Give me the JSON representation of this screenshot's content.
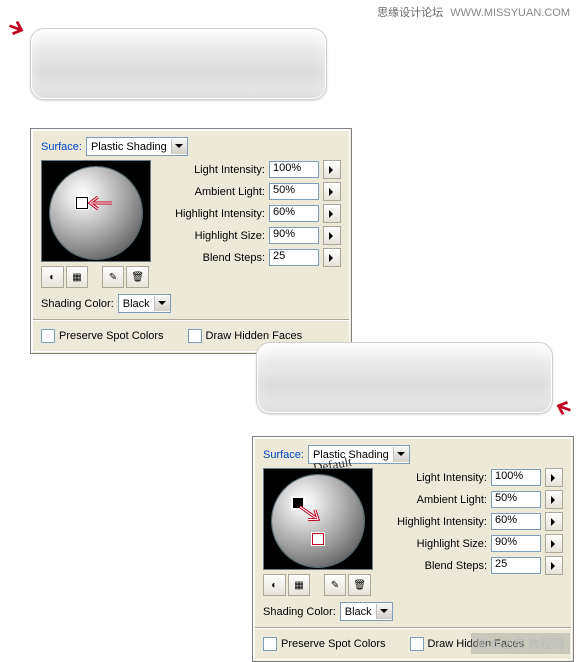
{
  "watermark": {
    "cn": "思缘设计论坛",
    "url": "WWW.MISSYUAN.COM",
    "bottom": "脚本之家 教程网"
  },
  "panel1": {
    "surface_label": "Surface:",
    "surface_value": "Plastic Shading",
    "sliders": {
      "light_intensity": {
        "label": "Light Intensity:",
        "value": "100%"
      },
      "ambient_light": {
        "label": "Ambient Light:",
        "value": "50%"
      },
      "highlight_intensity": {
        "label": "Highlight Intensity:",
        "value": "60%"
      },
      "highlight_size": {
        "label": "Highlight Size:",
        "value": "90%"
      },
      "blend_steps": {
        "label": "Blend Steps:",
        "value": "25"
      }
    },
    "shading_color_label": "Shading Color:",
    "shading_color_value": "Black",
    "cb_preserve": "Preserve Spot Colors",
    "cb_hidden": "Draw Hidden Faces",
    "toolbar_icons": {
      "a": "◐",
      "b": "▦",
      "c": "✎",
      "d": "🗑"
    }
  },
  "panel2": {
    "surface_label": "Surface:",
    "surface_value": "Plastic Shading",
    "default_note": "Default",
    "sliders": {
      "light_intensity": {
        "label": "Light Intensity:",
        "value": "100%"
      },
      "ambient_light": {
        "label": "Ambient Light:",
        "value": "50%"
      },
      "highlight_intensity": {
        "label": "Highlight Intensity:",
        "value": "60%"
      },
      "highlight_size": {
        "label": "Highlight Size:",
        "value": "90%"
      },
      "blend_steps": {
        "label": "Blend Steps:",
        "value": "25"
      }
    },
    "shading_color_label": "Shading Color:",
    "shading_color_value": "Black",
    "cb_preserve": "Preserve Spot Colors",
    "cb_hidden": "Draw Hidden Faces",
    "toolbar_icons": {
      "a": "◐",
      "b": "▦",
      "c": "✎",
      "d": "🗑"
    }
  }
}
